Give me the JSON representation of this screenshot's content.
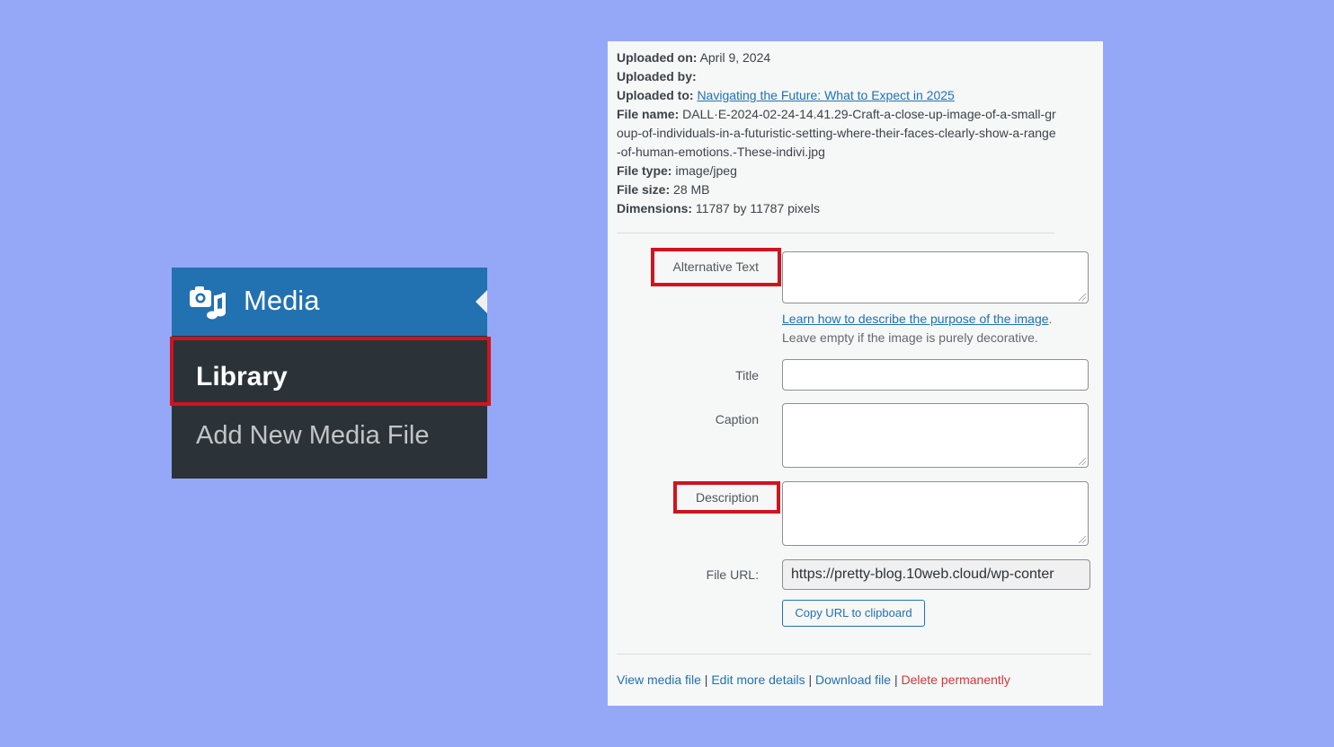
{
  "menu": {
    "title": "Media",
    "items": [
      {
        "label": "Library"
      },
      {
        "label": "Add New Media File"
      }
    ],
    "icon": "media-icon"
  },
  "details": {
    "uploaded_on_label": "Uploaded on:",
    "uploaded_on_value": "April 9, 2024",
    "uploaded_by_label": "Uploaded by:",
    "uploaded_to_label": "Uploaded to:",
    "uploaded_to_link": "Navigating the Future: What to Expect in 2025",
    "file_name_label": "File name:",
    "file_name_value": "DALL·E-2024-02-24-14.41.29-Craft-a-close-up-image-of-a-small-group-of-individuals-in-a-futuristic-setting-where-their-faces-clearly-show-a-range-of-human-emotions.-These-indivi.jpg",
    "file_type_label": "File type:",
    "file_type_value": "image/jpeg",
    "file_size_label": "File size:",
    "file_size_value": "28 MB",
    "dimensions_label": "Dimensions:",
    "dimensions_value": "11787 by 11787 pixels"
  },
  "form": {
    "alt_text_label": "Alternative Text",
    "help_link": "Learn how to describe the purpose of the image",
    "help_period": ".",
    "help_note": "Leave empty if the image is purely decorative.",
    "title_label": "Title",
    "caption_label": "Caption",
    "description_label": "Description",
    "file_url_label": "File URL:",
    "file_url_value": "https://pretty-blog.10web.cloud/wp-conter",
    "copy_button": "Copy URL to clipboard"
  },
  "actions": {
    "view": "View media file",
    "edit": "Edit more details",
    "download": "Download file",
    "delete": "Delete permanently",
    "separator": "|"
  },
  "colors": {
    "background": "#95a8f7",
    "highlight": "#d0141f",
    "wp_blue": "#2271b1",
    "menu_dark": "#2c3338",
    "danger": "#d63638"
  }
}
